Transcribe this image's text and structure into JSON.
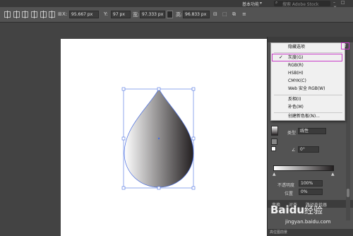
{
  "topbar": {
    "workspace": "基本功能",
    "search_placeholder": "搜索 Adobe Stock"
  },
  "control_bar": {
    "x_label": "X:",
    "x_value": "95.667 px",
    "y_label": "Y:",
    "y_value": "97 px",
    "w_label": "宽:",
    "w_value": "97.333 px",
    "h_label": "高:",
    "h_value": "96.833 px"
  },
  "menu": {
    "items": [
      {
        "label": "隐藏选项"
      },
      {
        "label": "灰度(G)",
        "checked": true
      },
      {
        "label": "RGB(R)"
      },
      {
        "label": "HSB(H)"
      },
      {
        "label": "CMYK(C)"
      },
      {
        "label": "Web 安全 RGB(W)"
      },
      {
        "label": "反相(I)"
      },
      {
        "label": "补色(M)"
      },
      {
        "label": "创建新色板(N)..."
      }
    ]
  },
  "gradient_panel": {
    "type_label": "类型",
    "type_value": "线性",
    "angle_value": "0°",
    "opacity_label": "不透明度",
    "opacity_value": "100%",
    "location_label": "位置",
    "location_value": "0%",
    "start_color": "#ffffff",
    "end_color": "#231f20"
  },
  "tabs": [
    "变换",
    "对齐",
    "路径查找器"
  ],
  "bottom_text": "高位图前景",
  "watermark": {
    "logo": "Baidu经验",
    "url": "jingyan.baidu.com"
  },
  "colors": {
    "highlight": "#c83cc8",
    "bounding_box": "#4a6ee0"
  }
}
